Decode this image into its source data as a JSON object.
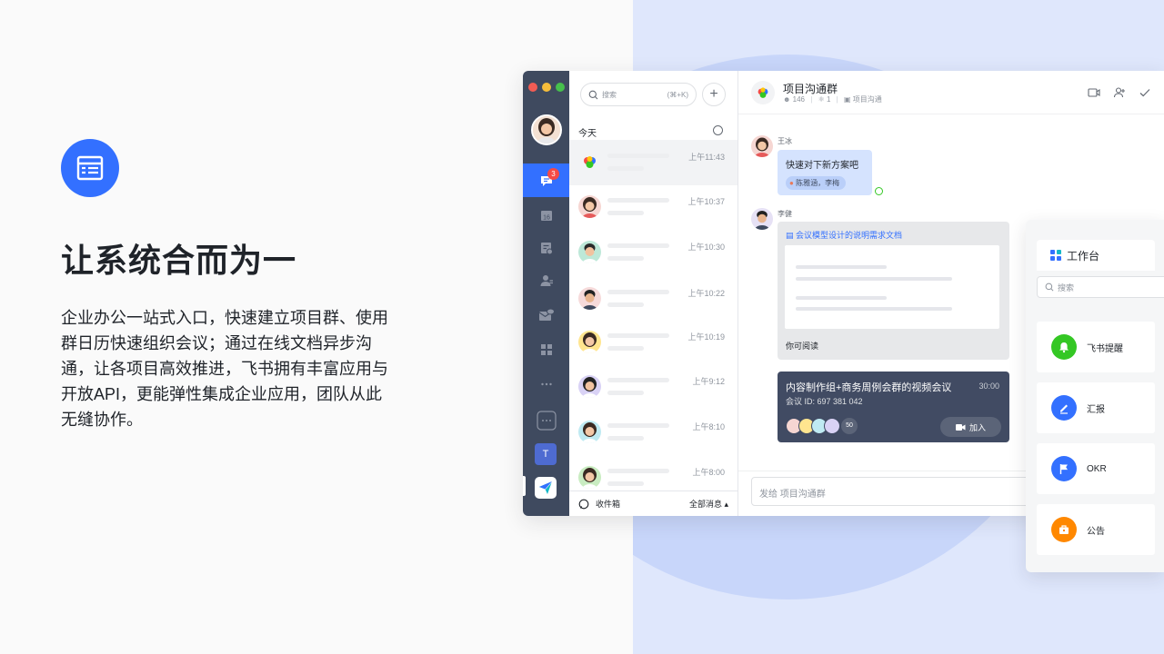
{
  "left": {
    "icon": "document-list-icon",
    "headline": "让系统合而为一",
    "description": "企业办公一站式入口，快速建立项目群、使用群日历快速组织会议；通过在线文档异步沟通，让各项目高效推进，飞书拥有丰富应用与开放API，更能弹性集成企业应用，团队从此无缝协作。"
  },
  "rail": {
    "badge_count": "3",
    "calendar_day": "16",
    "workspace_initial": "T"
  },
  "chat_list": {
    "search_placeholder": "搜索",
    "search_shortcut": "(⌘+K)",
    "section_title": "今天",
    "times": [
      "上午11:43",
      "上午10:37",
      "上午10:30",
      "上午10:22",
      "上午10:19",
      "上午9:12",
      "上午8:10",
      "上午8:00"
    ],
    "footer_inbox": "收件箱",
    "footer_all": "全部消息 ▴"
  },
  "chat": {
    "title": "项目沟通群",
    "members": "146",
    "bots": "1",
    "department": "项目沟通",
    "msg1_sender": "王冰",
    "msg1_text": "快速对下新方案吧",
    "msg1_mention": "陈雅涵，李梅",
    "msg2_sender": "李健",
    "doc_title": "会议模型设计的说明需求文档",
    "doc_footer": "你可阅读",
    "vc_title": "内容制作组+商务周例会群的视频会议",
    "vc_duration": "30:00",
    "vc_id": "会议 ID:  697 381 042",
    "vc_count": "50",
    "vc_join": "加入",
    "input_placeholder": "发给 项目沟通群"
  },
  "workbench": {
    "title": "工作台",
    "search_placeholder": "搜索",
    "apps": [
      {
        "label": "飞书提醒",
        "color": "#34c724"
      },
      {
        "label": "汇报",
        "color": "#3370ff"
      },
      {
        "label": "OKR",
        "color": "#3370ff"
      },
      {
        "label": "公告",
        "color": "#ff8800"
      }
    ]
  }
}
